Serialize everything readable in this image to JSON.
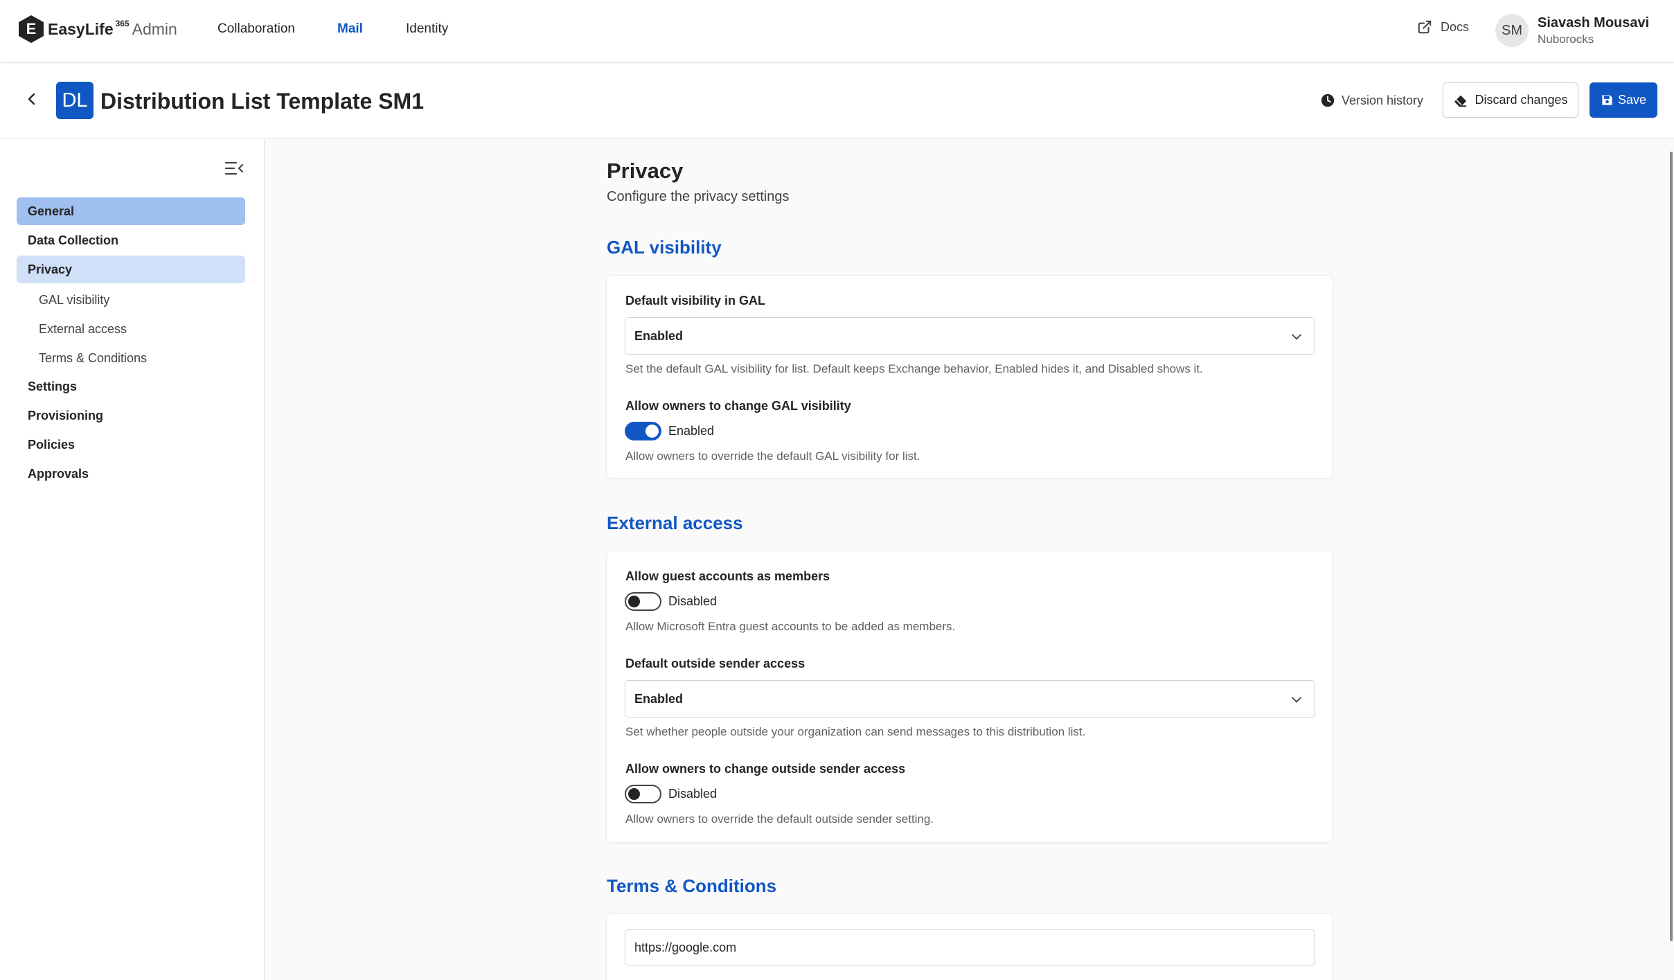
{
  "app": {
    "brand_letter": "E",
    "brand_name": "EasyLife",
    "brand_sup": "365",
    "brand_suffix": "Admin"
  },
  "nav": {
    "items": [
      {
        "label": "Collaboration"
      },
      {
        "label": "Mail"
      },
      {
        "label": "Identity"
      }
    ],
    "active": "Mail",
    "docs_label": "Docs"
  },
  "user": {
    "initials": "SM",
    "name": "Siavash Mousavi",
    "org": "Nuborocks"
  },
  "header": {
    "tile_initials": "DL",
    "title": "Distribution List Template SM1",
    "version_history": "Version history",
    "discard": "Discard changes",
    "save": "Save"
  },
  "sidebar": {
    "items": [
      {
        "label": "General"
      },
      {
        "label": "Data Collection"
      },
      {
        "label": "Privacy"
      },
      {
        "label": "GAL visibility"
      },
      {
        "label": "External access"
      },
      {
        "label": "Terms & Conditions"
      },
      {
        "label": "Settings"
      },
      {
        "label": "Provisioning"
      },
      {
        "label": "Policies"
      },
      {
        "label": "Approvals"
      }
    ]
  },
  "main": {
    "title": "Privacy",
    "subtitle": "Configure the privacy settings",
    "gal": {
      "title": "GAL visibility",
      "default_label": "Default visibility in GAL",
      "default_value": "Enabled",
      "default_help": "Set the default GAL visibility for list. Default keeps Exchange behavior, Enabled hides it, and Disabled shows it.",
      "owners_label": "Allow owners to change GAL visibility",
      "owners_state": "Enabled",
      "owners_on": true,
      "owners_help": "Allow owners to override the default GAL visibility for list."
    },
    "external": {
      "title": "External access",
      "guest_label": "Allow guest accounts as members",
      "guest_state": "Disabled",
      "guest_on": false,
      "guest_help": "Allow Microsoft Entra guest accounts to be added as members.",
      "sender_label": "Default outside sender access",
      "sender_value": "Enabled",
      "sender_help": "Set whether people outside your organization can send messages to this distribution list.",
      "owners_label": "Allow owners to change outside sender access",
      "owners_state": "Disabled",
      "owners_on": false,
      "owners_help": "Allow owners to override the default outside sender setting."
    },
    "terms": {
      "title": "Terms & Conditions",
      "url_value": "https://google.com"
    }
  },
  "icons": [
    "back-arrow-icon",
    "external-link-icon",
    "clock-icon",
    "eraser-icon",
    "save-icon",
    "collapse-menu-icon",
    "chevron-down-icon"
  ],
  "colors": {
    "accent": "#1157c4",
    "sidebar_active": "#9fc0f0",
    "sidebar_selected": "#cfe0f8"
  }
}
